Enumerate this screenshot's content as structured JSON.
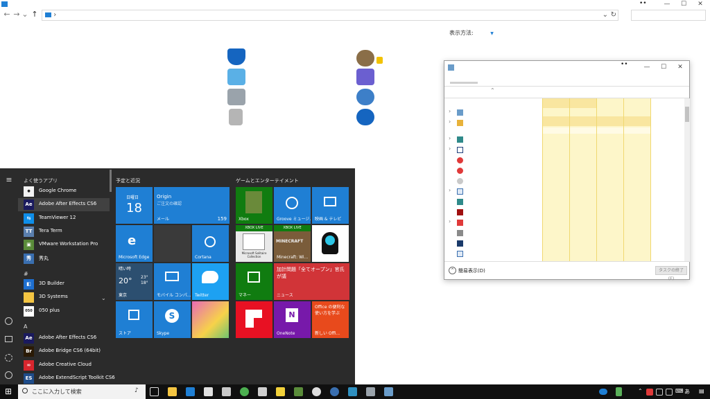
{
  "explorer": {
    "title_dots": "••",
    "min_label": "—",
    "max_label": "☐",
    "close_label": "✕",
    "back_label": "←",
    "forward_label": "→",
    "down_label": "⌄",
    "up_label": "↑",
    "address_separator": "›",
    "refresh_label": "↻",
    "view_by_label": "表示方法:",
    "view_by_arrow": "▼"
  },
  "task_manager": {
    "title_dots": "••",
    "min_label": "—",
    "max_label": "☐",
    "close_label": "✕",
    "sort_arrow": "⌃",
    "fewer_details_label": "簡易表示(D)",
    "end_task_label": "タスクの終了(E)",
    "row_arrow": "›"
  },
  "start_menu": {
    "hamburger": "≡",
    "most_used_header": "よく使うアプリ",
    "apps_most_used": [
      {
        "name": "Google Chrome",
        "icon": "chrome-icon",
        "color": "#f2f2f2",
        "glyph": "●"
      },
      {
        "name": "Adobe After Effects CS6",
        "icon": "after-effects-icon",
        "color": "#1a1a5e",
        "glyph": "Ae"
      },
      {
        "name": "TeamViewer 12",
        "icon": "teamviewer-icon",
        "color": "#0e8ee9",
        "glyph": "⇆"
      },
      {
        "name": "Tera Term",
        "icon": "tera-term-icon",
        "color": "#5a7fae",
        "glyph": "TT"
      },
      {
        "name": "VMware Workstation Pro",
        "icon": "vmware-icon",
        "color": "#5a8c3a",
        "glyph": "▣"
      },
      {
        "name": "秀丸",
        "icon": "hidemaru-icon",
        "color": "#3a6fb0",
        "glyph": "秀"
      }
    ],
    "hash_header": "#",
    "apps_hash": [
      {
        "name": "3D Builder",
        "icon": "3d-builder-icon",
        "color": "#1e6fd0",
        "glyph": "◧"
      },
      {
        "name": "3D Systems",
        "icon": "folder-icon",
        "color": "#f4c542",
        "glyph": "▬"
      },
      {
        "name": "050 plus",
        "icon": "050plus-icon",
        "color": "#ffffff",
        "glyph": "050"
      }
    ],
    "expand_arrow": "⌄",
    "a_header": "A",
    "apps_a": [
      {
        "name": "Adobe After Effects CS6",
        "icon": "after-effects-icon",
        "color": "#1a1a5e",
        "glyph": "Ae"
      },
      {
        "name": "Adobe Bridge CS6 (64bit)",
        "icon": "bridge-icon",
        "color": "#2a1a05",
        "glyph": "Br"
      },
      {
        "name": "Adobe Creative Cloud",
        "icon": "creative-cloud-icon",
        "color": "#d8262e",
        "glyph": "∞"
      },
      {
        "name": "Adobe ExtendScript Toolkit CS6",
        "icon": "extendscript-icon",
        "color": "#1e4c8a",
        "glyph": "ES"
      }
    ],
    "group_schedule": "予定と近況",
    "group_games": "ゲームとエンターテイメント",
    "calendar": {
      "day": "日曜日",
      "date": "18"
    },
    "mail": {
      "sender": "Origin",
      "subject": "ご注文の確認",
      "label": "メール",
      "count": "159"
    },
    "edge_label": "Microsoft Edge",
    "cortana_label": "Cortana",
    "weather": {
      "condition": "晴い時",
      "temp": "20°",
      "high": "23°",
      "low": "18°",
      "city": "東京"
    },
    "mobile_label": "モバイル コンパ...",
    "twitter_label": "Twitter",
    "store_label": "ストア",
    "skype_label": "Skype",
    "xbox_label": "Xbox",
    "groove_label": "Groove ミュージ...",
    "movies_label": "映画 & テレビ",
    "xbox_live_badge": "XBOX LIVE",
    "solitaire_label": "Microsoft Solitaire Collection",
    "minecraft_label": "MINECRAFT",
    "minecraft_sub": "Minecraft: Wi...",
    "news": {
      "headline": "加計問題「全てオープン」官氏が議",
      "footer": "ニュース"
    },
    "money_label": "マネー",
    "onenote_label": "OneNote",
    "office": {
      "text": "Office の便利な使い方を学ぶ",
      "label": "新しい Offi..."
    }
  },
  "taskbar": {
    "start_glyph": "⊞",
    "search_placeholder": "ここに入力して検索",
    "mic_glyph": "♪",
    "ime_label": "あ",
    "notification_glyph": "▤"
  },
  "colors": {
    "accent": "#1f7fd4",
    "start_bg": "#2b2b2b",
    "taskbar_bg": "#101010",
    "tm_highlight": "#fdf6c9"
  }
}
